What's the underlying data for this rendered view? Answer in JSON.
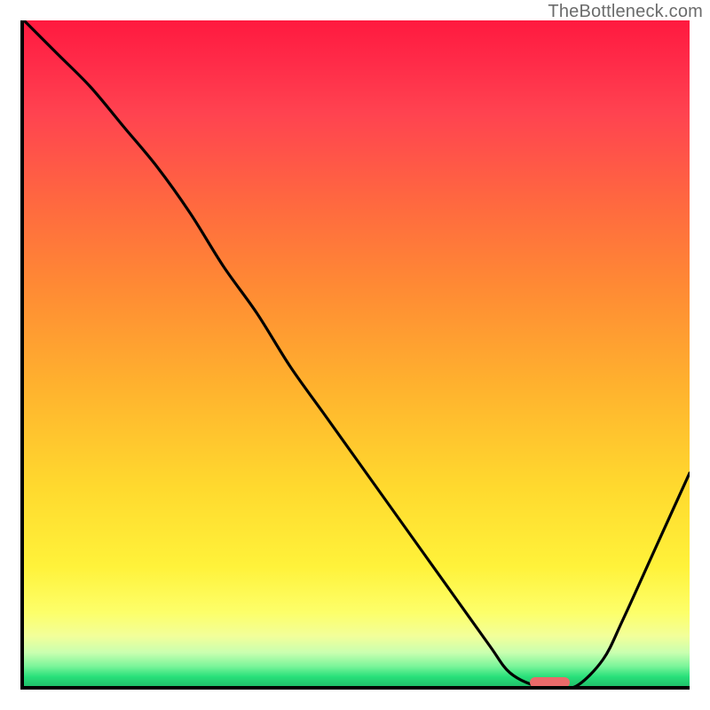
{
  "watermark": "TheBottleneck.com",
  "chart_data": {
    "type": "line",
    "title": "",
    "xlabel": "",
    "ylabel": "",
    "xlim": [
      0,
      100
    ],
    "ylim": [
      0,
      100
    ],
    "grid": false,
    "legend": false,
    "background_gradient": {
      "direction": "vertical",
      "stops": [
        {
          "pos": 0,
          "color": "#ff1a3f"
        },
        {
          "pos": 28,
          "color": "#ff6a3f"
        },
        {
          "pos": 55,
          "color": "#ffb22e"
        },
        {
          "pos": 82,
          "color": "#fff23a"
        },
        {
          "pos": 95,
          "color": "#c9ffb0"
        },
        {
          "pos": 100,
          "color": "#20c06a"
        }
      ]
    },
    "series": [
      {
        "name": "bottleneck-curve",
        "color": "#000000",
        "x": [
          0,
          5,
          10,
          15,
          20,
          25,
          30,
          35,
          40,
          45,
          50,
          55,
          60,
          65,
          70,
          73,
          77,
          80,
          83,
          87,
          90,
          95,
          100
        ],
        "y": [
          100,
          95,
          90,
          84,
          78,
          71,
          63,
          56,
          48,
          41,
          34,
          27,
          20,
          13,
          6,
          2,
          0,
          0,
          0,
          4,
          10,
          21,
          32
        ]
      }
    ],
    "marker": {
      "name": "optimal-range",
      "color": "#ea6a6a",
      "x_start": 76,
      "x_end": 82,
      "y": 0
    }
  }
}
